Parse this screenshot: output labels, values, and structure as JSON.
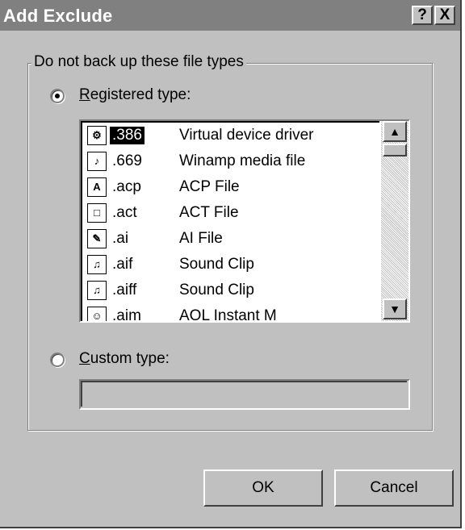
{
  "window": {
    "title": "Add Exclude",
    "help_label": "?",
    "close_label": "X"
  },
  "group": {
    "label": "Do not back up these file types"
  },
  "registered": {
    "label_first": "R",
    "label_rest": "egistered type:",
    "selected": true
  },
  "list": {
    "items": [
      {
        "ext": ".386",
        "desc": "Virtual device driver",
        "icon": "driver-icon",
        "glyph": "⚙"
      },
      {
        "ext": ".669",
        "desc": "Winamp media file",
        "icon": "media-icon",
        "glyph": "♪"
      },
      {
        "ext": ".acp",
        "desc": "ACP File",
        "icon": "acp-icon",
        "glyph": "A"
      },
      {
        "ext": ".act",
        "desc": "ACT File",
        "icon": "act-icon",
        "glyph": "□"
      },
      {
        "ext": ".ai",
        "desc": "AI File",
        "icon": "ai-icon",
        "glyph": "✎"
      },
      {
        "ext": ".aif",
        "desc": "Sound Clip",
        "icon": "sound-icon",
        "glyph": "♫"
      },
      {
        "ext": ".aiff",
        "desc": "Sound Clip",
        "icon": "sound-icon",
        "glyph": "♫"
      },
      {
        "ext": ".aim",
        "desc": "AOL Instant M",
        "icon": "aim-icon",
        "glyph": "☺"
      }
    ],
    "scroll_up": "▲",
    "scroll_down": "▼"
  },
  "custom": {
    "label_first": "C",
    "label_rest": "ustom type:",
    "value": "",
    "selected": false
  },
  "buttons": {
    "ok": "OK",
    "cancel": "Cancel"
  }
}
